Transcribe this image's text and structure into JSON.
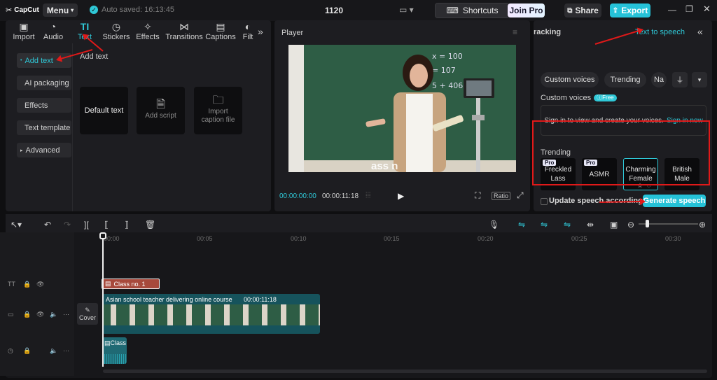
{
  "app": {
    "logo": "CapCut",
    "menu_label": "Menu",
    "autosave": "Auto saved: 16:13:45",
    "project_name": "1120"
  },
  "topbar": {
    "shortcuts": "Shortcuts",
    "join_pro": "Join Pro",
    "share": "Share",
    "export": "Export"
  },
  "tabs": [
    {
      "label": "Import",
      "icon": "import-icon"
    },
    {
      "label": "Audio",
      "icon": "audio-icon"
    },
    {
      "label": "Text",
      "icon": "text-icon",
      "active": true
    },
    {
      "label": "Stickers",
      "icon": "sticker-icon"
    },
    {
      "label": "Effects",
      "icon": "effects-icon"
    },
    {
      "label": "Transitions",
      "icon": "transitions-icon"
    },
    {
      "label": "Captions",
      "icon": "captions-icon"
    },
    {
      "label": "Filt",
      "icon": "filters-icon"
    }
  ],
  "sidebar": {
    "items": [
      "Add text",
      "AI packaging",
      "Effects",
      "Text template",
      "Advanced"
    ]
  },
  "text_panel": {
    "heading": "Add text",
    "default_text": "Default text",
    "add_script": "Add script",
    "import_caption": "Import caption file"
  },
  "player": {
    "title": "Player",
    "current_time": "00:00:00:00",
    "total_time": "00:00:11:18",
    "ratio": "Ratio",
    "overlay_text": "ass n"
  },
  "tts": {
    "tab_partial": "racking",
    "tab_active": "Text to speech",
    "filters": [
      "Custom voices",
      "Trending",
      "Na"
    ],
    "custom_heading": "Custom voices",
    "free_badge": "Free",
    "sign_in_text": "Sign in to view and create your voices.",
    "sign_in_link": "Sign in now",
    "trending_heading": "Trending",
    "voices": [
      {
        "name": "Freckled Lass",
        "pro": "Pro"
      },
      {
        "name": "ASMR",
        "pro": "Pro"
      },
      {
        "name": "Charming Female",
        "pro": ""
      },
      {
        "name": "British Male",
        "pro": ""
      }
    ],
    "update_label": "Update speech according to",
    "generate_button": "Generate speech"
  },
  "timeline": {
    "ruler": [
      "00:00",
      "00:05",
      "00:10",
      "00:15",
      "00:20",
      "00:25",
      "00:30"
    ],
    "text_clip": "Class no. 1",
    "video_clip_title": "Asian school teacher delivering online course",
    "video_clip_duration": "00:00:11:18",
    "audio_clip": "Class",
    "cover_label": "Cover"
  },
  "colors": {
    "accent": "#2fc8d7",
    "highlight": "#e01919",
    "text_clip": "#a7493b",
    "video_clip": "#16535c"
  }
}
